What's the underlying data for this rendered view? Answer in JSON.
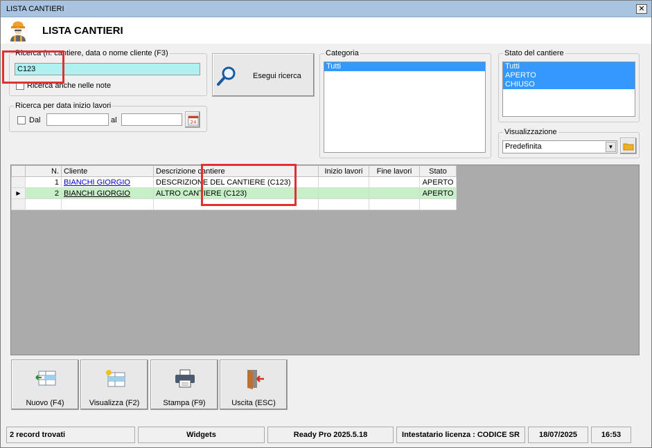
{
  "window": {
    "title": "LISTA CANTIERI",
    "close_label": "✕"
  },
  "header": {
    "title": "LISTA CANTIERI"
  },
  "search": {
    "legend": "Ricerca (n. cantiere, data o nome cliente (F3)",
    "value": "C123",
    "notes_label": "Ricerca anche nelle note",
    "button_label": "Esegui ricerca"
  },
  "date_filter": {
    "legend": "Ricerca per data inizio lavori",
    "from_label": "Dal",
    "to_label": "al",
    "from_value": "",
    "to_value": "",
    "calendar_day": "24"
  },
  "category": {
    "legend": "Categoria",
    "items": [
      "Tutti"
    ]
  },
  "state": {
    "legend": "Stato del cantiere",
    "items": [
      "Tutti",
      "APERTO",
      "CHIUSO"
    ]
  },
  "view": {
    "legend": "Visualizzazione",
    "selected": "Predefinita"
  },
  "grid": {
    "columns": [
      "N.",
      "Cliente",
      "Descrizione cantiere",
      "Inizio lavori",
      "Fine lavori",
      "Stato"
    ],
    "rows": [
      {
        "n": "1",
        "cliente": "BIANCHI GIORGIO",
        "descrizione": "DESCRIZIONE DEL CANTIERE (C123)",
        "inizio": "",
        "fine": "",
        "stato": "APERTO"
      },
      {
        "n": "2",
        "cliente": "BIANCHI GIORGIO",
        "descrizione": "ALTRO CANTIERE  (C123)",
        "inizio": "",
        "fine": "",
        "stato": "APERTO"
      }
    ]
  },
  "actions": {
    "new": "Nuovo (F4)",
    "view": "Visualizza (F2)",
    "print": "Stampa (F9)",
    "exit": "Uscita (ESC)"
  },
  "statusbar": {
    "records": "2 record trovati",
    "widgets": "Widgets",
    "version": "Ready Pro 2025.5.18",
    "license": "Intestatario licenza : CODICE SR",
    "date": "18/07/2025",
    "time": "16:53"
  },
  "colors": {
    "search_bg": "#b0f0f0",
    "selection": "#3399ff",
    "row_selected": "#c8f0c8",
    "highlight": "#e03030"
  }
}
